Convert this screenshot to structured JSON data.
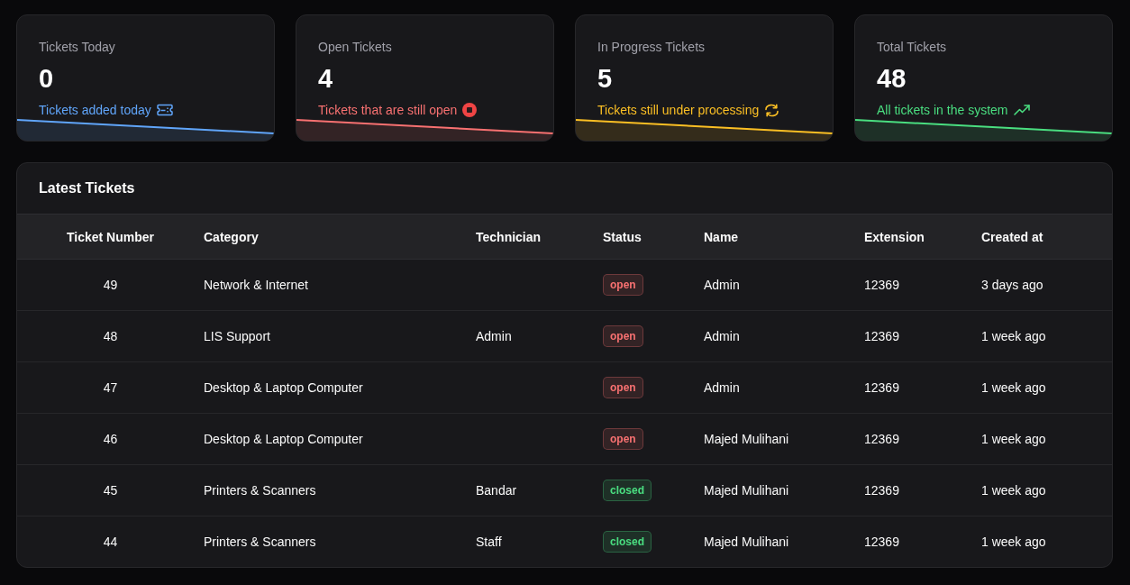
{
  "cards": [
    {
      "kind": "today",
      "title": "Tickets Today",
      "value": "0",
      "subtitle": "Tickets added today",
      "color": "#60a5fa"
    },
    {
      "kind": "open",
      "title": "Open Tickets",
      "value": "4",
      "subtitle": "Tickets that are still open",
      "color": "#f87171"
    },
    {
      "kind": "progress",
      "title": "In Progress Tickets",
      "value": "5",
      "subtitle": "Tickets still under processing",
      "color": "#fbbf24"
    },
    {
      "kind": "total",
      "title": "Total Tickets",
      "value": "48",
      "subtitle": "All tickets in the system",
      "color": "#4ade80"
    }
  ],
  "table": {
    "title": "Latest Tickets",
    "columns": [
      "Ticket Number",
      "Category",
      "Technician",
      "Status",
      "Name",
      "Extension",
      "Created at"
    ],
    "rows": [
      {
        "ticket_number": "49",
        "category": "Network & Internet",
        "status": {
          "label": "open",
          "color": "#f87171"
        },
        "name": "Admin",
        "extension": "12369",
        "created_at": "3 days ago"
      },
      {
        "ticket_number": "48",
        "category": "LIS Support",
        "technician": "Admin",
        "status": {
          "label": "open",
          "color": "#f87171"
        },
        "name": "Admin",
        "extension": "12369",
        "created_at": "1 week ago"
      },
      {
        "ticket_number": "47",
        "category": "Desktop & Laptop Computer",
        "status": {
          "label": "open",
          "color": "#f87171"
        },
        "name": "Admin",
        "extension": "12369",
        "created_at": "1 week ago"
      },
      {
        "ticket_number": "46",
        "category": "Desktop & Laptop Computer",
        "status": {
          "label": "open",
          "color": "#f87171"
        },
        "name": "Majed Mulihani",
        "extension": "12369",
        "created_at": "1 week ago"
      },
      {
        "ticket_number": "45",
        "category": "Printers & Scanners",
        "technician": "Bandar",
        "status": {
          "label": "closed",
          "color": "#4ade80"
        },
        "name": "Majed Mulihani",
        "extension": "12369",
        "created_at": "1 week ago"
      },
      {
        "ticket_number": "44",
        "category": "Printers & Scanners",
        "technician": "Staff",
        "status": {
          "label": "closed",
          "color": "#4ade80"
        },
        "name": "Majed Mulihani",
        "extension": "12369",
        "created_at": "1 week ago"
      }
    ]
  }
}
